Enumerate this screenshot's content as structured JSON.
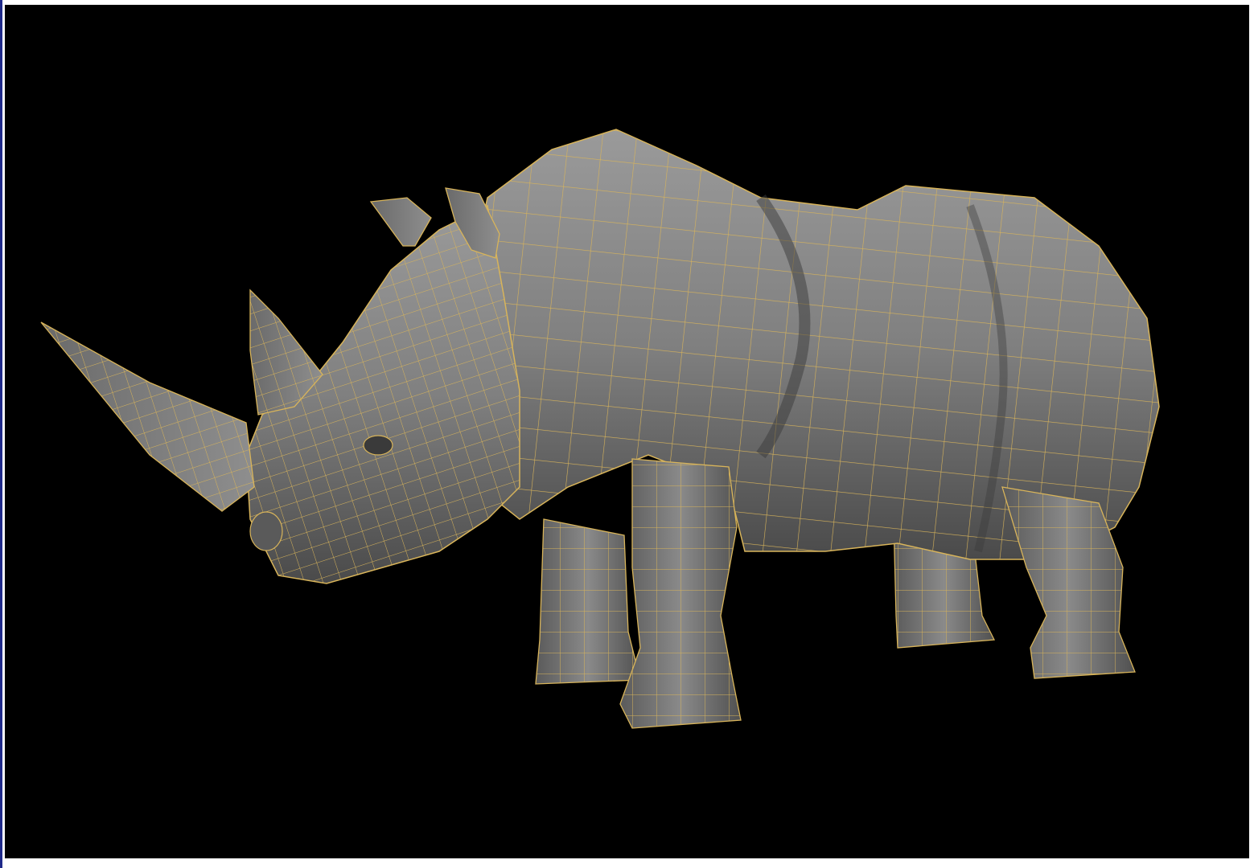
{
  "viewport": {
    "background": "#000000",
    "wire_color": "#d8b45a",
    "model": "rhino-wireframe-mesh",
    "shading": "smooth-gray-with-wireframe-overlay"
  },
  "frame": {
    "border_color": "#1f2a8a"
  }
}
